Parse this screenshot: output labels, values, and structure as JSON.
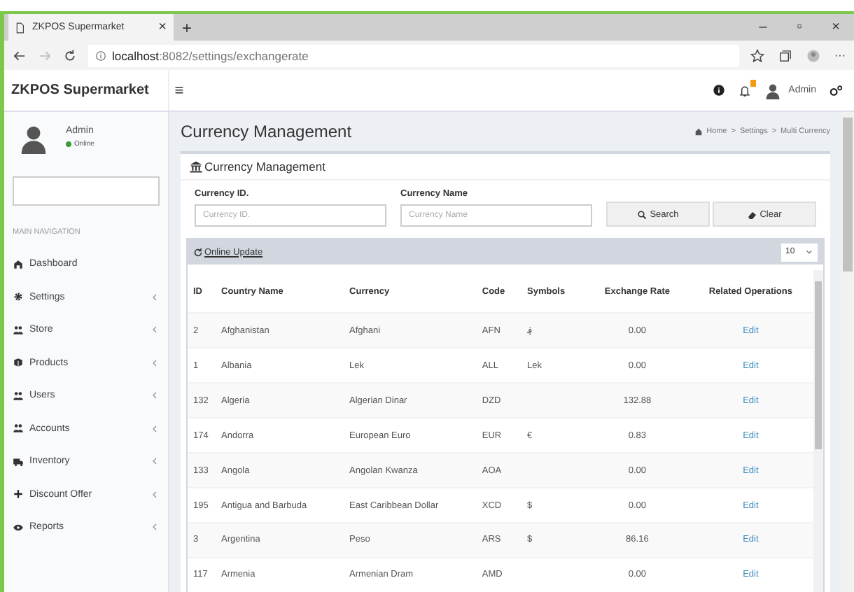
{
  "browser": {
    "tab_title": "ZKPOS Supermarket",
    "close_tab": "×",
    "new_tab": "+",
    "url_host": "localhost",
    "url_path": ":8082/settings/exchangerate",
    "window_buttons": [
      "–",
      "▫",
      "×"
    ],
    "menu": "···"
  },
  "header": {
    "brand": "ZKPOS Supermarket",
    "menu_glyph": "≡",
    "user": "Admin"
  },
  "sidebar": {
    "user": "Admin",
    "status": "Online",
    "nav_header": "MAIN NAVIGATION",
    "items": [
      {
        "label": "Dashboard",
        "expandable": false
      },
      {
        "label": "Settings",
        "expandable": true
      },
      {
        "label": "Store",
        "expandable": true
      },
      {
        "label": "Products",
        "expandable": true
      },
      {
        "label": "Users",
        "expandable": true
      },
      {
        "label": "Accounts",
        "expandable": true
      },
      {
        "label": "Inventory",
        "expandable": true
      },
      {
        "label": "Discount Offer",
        "expandable": true
      },
      {
        "label": "Reports",
        "expandable": true
      }
    ]
  },
  "content": {
    "title": "Currency Management",
    "breadcrumb": [
      "Home",
      "Settings",
      "Multi Currency"
    ],
    "breadcrumb_separator": ">",
    "box_title": "Currency Management",
    "filters": [
      {
        "label": "Currency ID.",
        "placeholder": "Currency ID."
      },
      {
        "label": "Currency Name",
        "placeholder": "Currency Name"
      }
    ],
    "buttons": [
      "Search",
      "Clear"
    ],
    "online_update": "Online Update",
    "page_size": "10",
    "table": {
      "columns": [
        "ID",
        "Country Name",
        "Currency",
        "Code",
        "Symbols",
        "Exchange Rate",
        "Related Operations"
      ],
      "rows": [
        [
          "2",
          "Afghanistan",
          "Afghani",
          "AFN",
          "؋",
          "0.00",
          "Edit"
        ],
        [
          "1",
          "Albania",
          "Lek",
          "ALL",
          "Lek",
          "0.00",
          "Edit"
        ],
        [
          "132",
          "Algeria",
          "Algerian Dinar",
          "DZD",
          "",
          "132.88",
          "Edit"
        ],
        [
          "174",
          "Andorra",
          "European Euro",
          "EUR",
          "€",
          "0.83",
          "Edit"
        ],
        [
          "133",
          "Angola",
          "Angolan Kwanza",
          "AOA",
          "",
          "0.00",
          "Edit"
        ],
        [
          "195",
          "Antigua and Barbuda",
          "East Caribbean Dollar",
          "XCD",
          "$",
          "0.00",
          "Edit"
        ],
        [
          "3",
          "Argentina",
          "Peso",
          "ARS",
          "$",
          "86.16",
          "Edit"
        ],
        [
          "117",
          "Armenia",
          "Armenian Dram",
          "AMD",
          "",
          "0.00",
          "Edit"
        ]
      ]
    }
  }
}
